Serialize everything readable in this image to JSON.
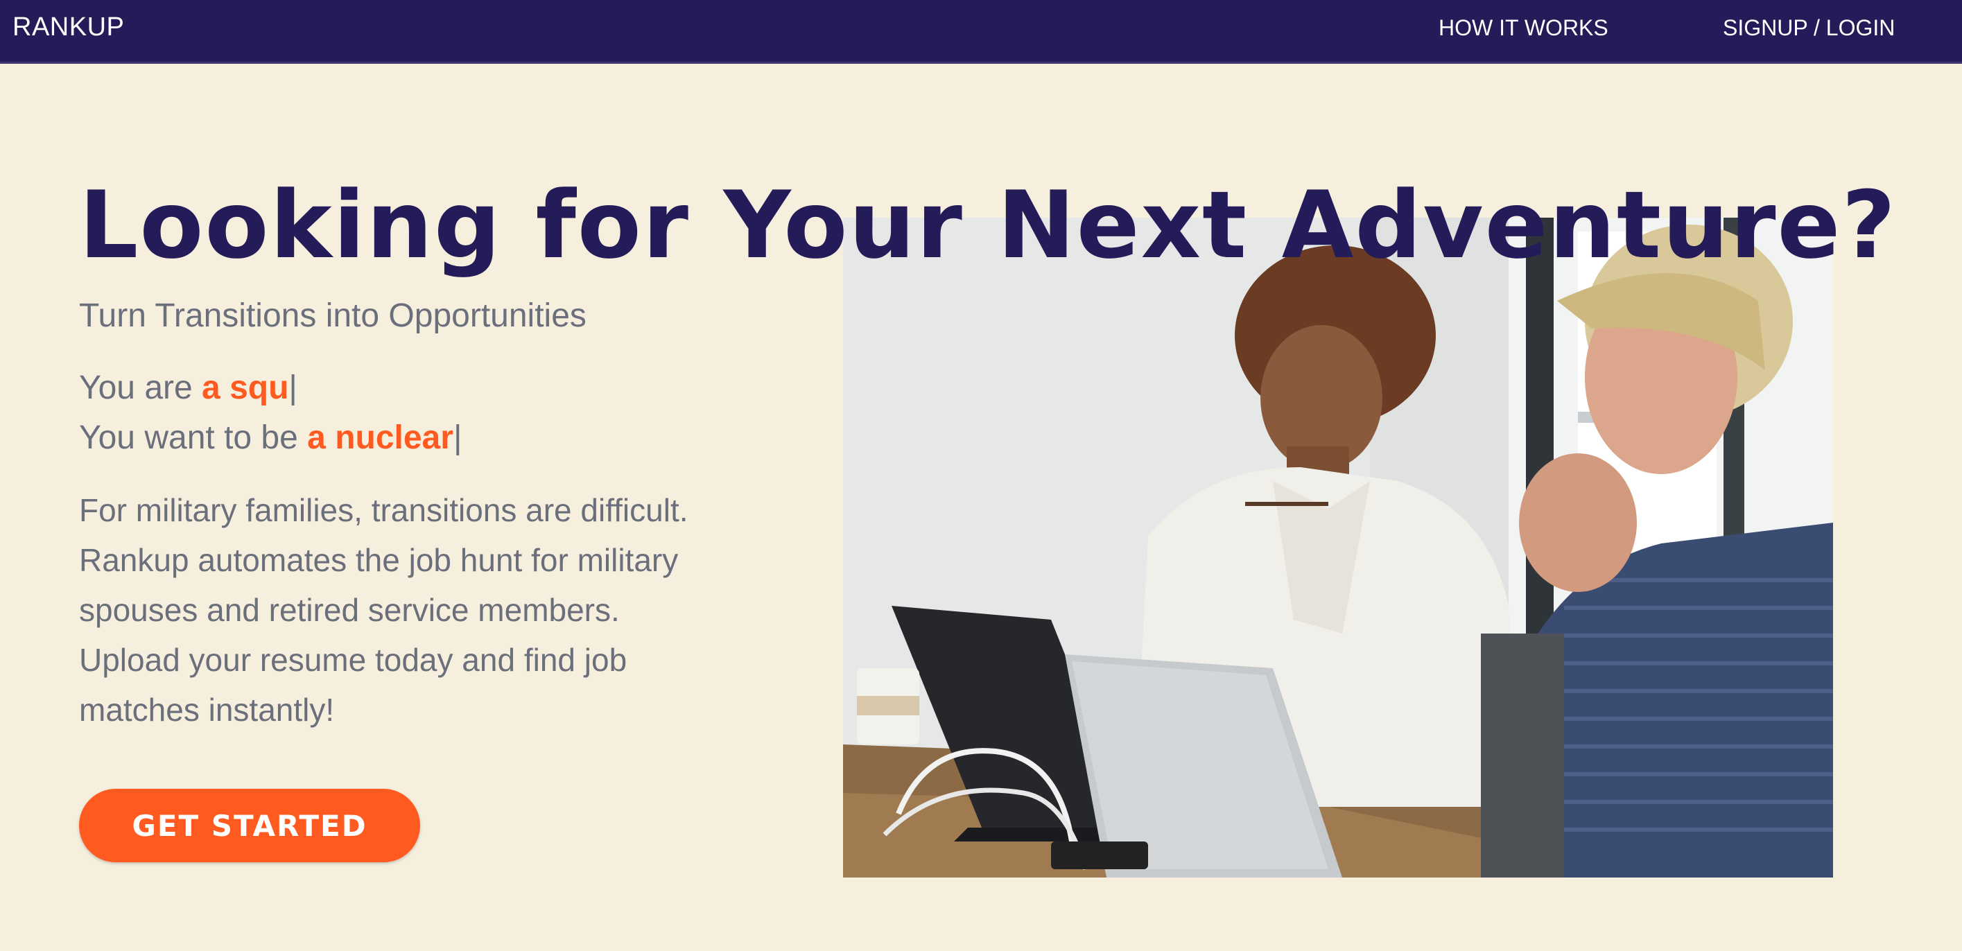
{
  "nav": {
    "brand": "RANKUP",
    "links": [
      "HOW IT WORKS",
      "SIGNUP / LOGIN"
    ]
  },
  "hero": {
    "title": "Looking for Your Next Adventure?",
    "subtitle": "Turn Transitions into Opportunities",
    "line1_prefix": "You are ",
    "line1_highlight": "a squ",
    "line2_prefix": "You want to be ",
    "line2_highlight": "a nuclear",
    "cursor": "|",
    "description": "For military families, transitions are difficult. Rankup automates the job hunt for military spouses and retired service members. Upload your resume today and find job matches instantly!",
    "cta": "GET STARTED"
  },
  "colors": {
    "navy": "#241c58",
    "orange": "#ff5a1f",
    "cream": "#f7efde",
    "gray_text": "#6b6f7c"
  }
}
